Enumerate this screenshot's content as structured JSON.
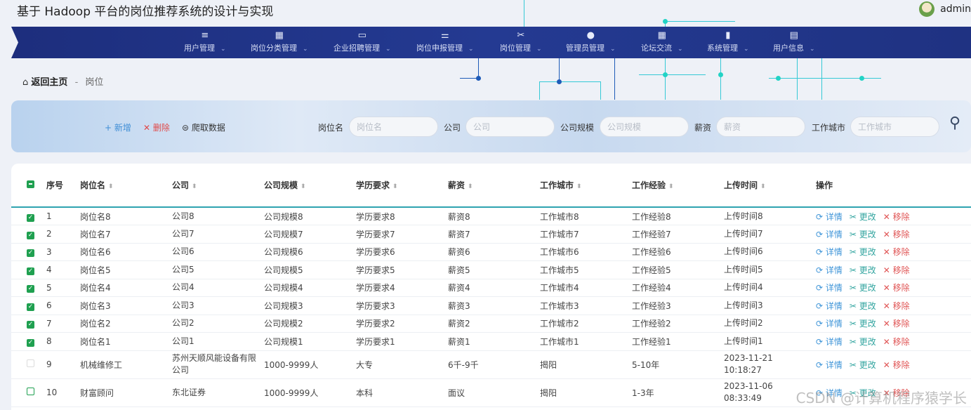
{
  "app": {
    "title": "基于 Hadoop 平台的岗位推荐系统的设计与实现",
    "user": "admin"
  },
  "nav": [
    {
      "icon": "≡",
      "label": "用户管理"
    },
    {
      "icon": "▦",
      "label": "岗位分类管理"
    },
    {
      "icon": "▭",
      "label": "企业招聘管理"
    },
    {
      "icon": "⚌",
      "label": "岗位申报管理"
    },
    {
      "icon": "✂",
      "label": "岗位管理"
    },
    {
      "icon": "●",
      "label": "管理员管理"
    },
    {
      "icon": "▦",
      "label": "论坛交流"
    },
    {
      "icon": "▮",
      "label": "系统管理"
    },
    {
      "icon": "▤",
      "label": "用户信息"
    }
  ],
  "breadcrumb": {
    "home": "返回主页",
    "sep": "-",
    "current": "岗位"
  },
  "actions": {
    "add": "+ 新增",
    "delete": "✕ 删除",
    "crawl": "⊜ 爬取数据"
  },
  "filters": [
    {
      "label": "岗位名",
      "placeholder": "岗位名"
    },
    {
      "label": "公司",
      "placeholder": "公司"
    },
    {
      "label": "公司规模",
      "placeholder": "公司规模"
    },
    {
      "label": "薪资",
      "placeholder": "薪资"
    },
    {
      "label": "工作城市",
      "placeholder": "工作城市"
    }
  ],
  "table": {
    "headers": [
      "序号",
      "岗位名",
      "公司",
      "公司规模",
      "学历要求",
      "薪资",
      "工作城市",
      "工作经验",
      "上传时间",
      "操作"
    ],
    "ops": {
      "detail": "⟳ 详情",
      "edit": "✂ 更改",
      "remove": "✕ 移除"
    },
    "rows": [
      {
        "checked": true,
        "cells": [
          "1",
          "岗位名8",
          "公司8",
          "公司规模8",
          "学历要求8",
          "薪资8",
          "工作城市8",
          "工作经验8",
          "上传时间8"
        ]
      },
      {
        "checked": true,
        "cells": [
          "2",
          "岗位名7",
          "公司7",
          "公司规模7",
          "学历要求7",
          "薪资7",
          "工作城市7",
          "工作经验7",
          "上传时间7"
        ]
      },
      {
        "checked": true,
        "cells": [
          "3",
          "岗位名6",
          "公司6",
          "公司规模6",
          "学历要求6",
          "薪资6",
          "工作城市6",
          "工作经验6",
          "上传时间6"
        ]
      },
      {
        "checked": true,
        "cells": [
          "4",
          "岗位名5",
          "公司5",
          "公司规模5",
          "学历要求5",
          "薪资5",
          "工作城市5",
          "工作经验5",
          "上传时间5"
        ]
      },
      {
        "checked": true,
        "cells": [
          "5",
          "岗位名4",
          "公司4",
          "公司规模4",
          "学历要求4",
          "薪资4",
          "工作城市4",
          "工作经验4",
          "上传时间4"
        ]
      },
      {
        "checked": true,
        "cells": [
          "6",
          "岗位名3",
          "公司3",
          "公司规模3",
          "学历要求3",
          "薪资3",
          "工作城市3",
          "工作经验3",
          "上传时间3"
        ]
      },
      {
        "checked": true,
        "cells": [
          "7",
          "岗位名2",
          "公司2",
          "公司规模2",
          "学历要求2",
          "薪资2",
          "工作城市2",
          "工作经验2",
          "上传时间2"
        ]
      },
      {
        "checked": true,
        "cells": [
          "8",
          "岗位名1",
          "公司1",
          "公司规模1",
          "学历要求1",
          "薪资1",
          "工作城市1",
          "工作经验1",
          "上传时间1"
        ]
      },
      {
        "checked": false,
        "cells": [
          "9",
          "机械维修工",
          "苏州天顺风能设备有限公司",
          "1000-9999人",
          "大专",
          "6千-9千",
          "揭阳",
          "5-10年",
          "2023-11-21 10:18:27"
        ]
      },
      {
        "checked": false,
        "cells": [
          "10",
          "财富顾问",
          "东北证券",
          "1000-9999人",
          "本科",
          "面议",
          "揭阳",
          "1-3年",
          "2023-11-06 08:33:49"
        ]
      }
    ]
  },
  "watermark": "CSDN @计算机程序猿学长",
  "colors": {
    "nav": "#1f3282",
    "accent": "#2fa3b0",
    "check": "#1fa050",
    "danger": "#e05555",
    "link": "#3f95d8"
  }
}
